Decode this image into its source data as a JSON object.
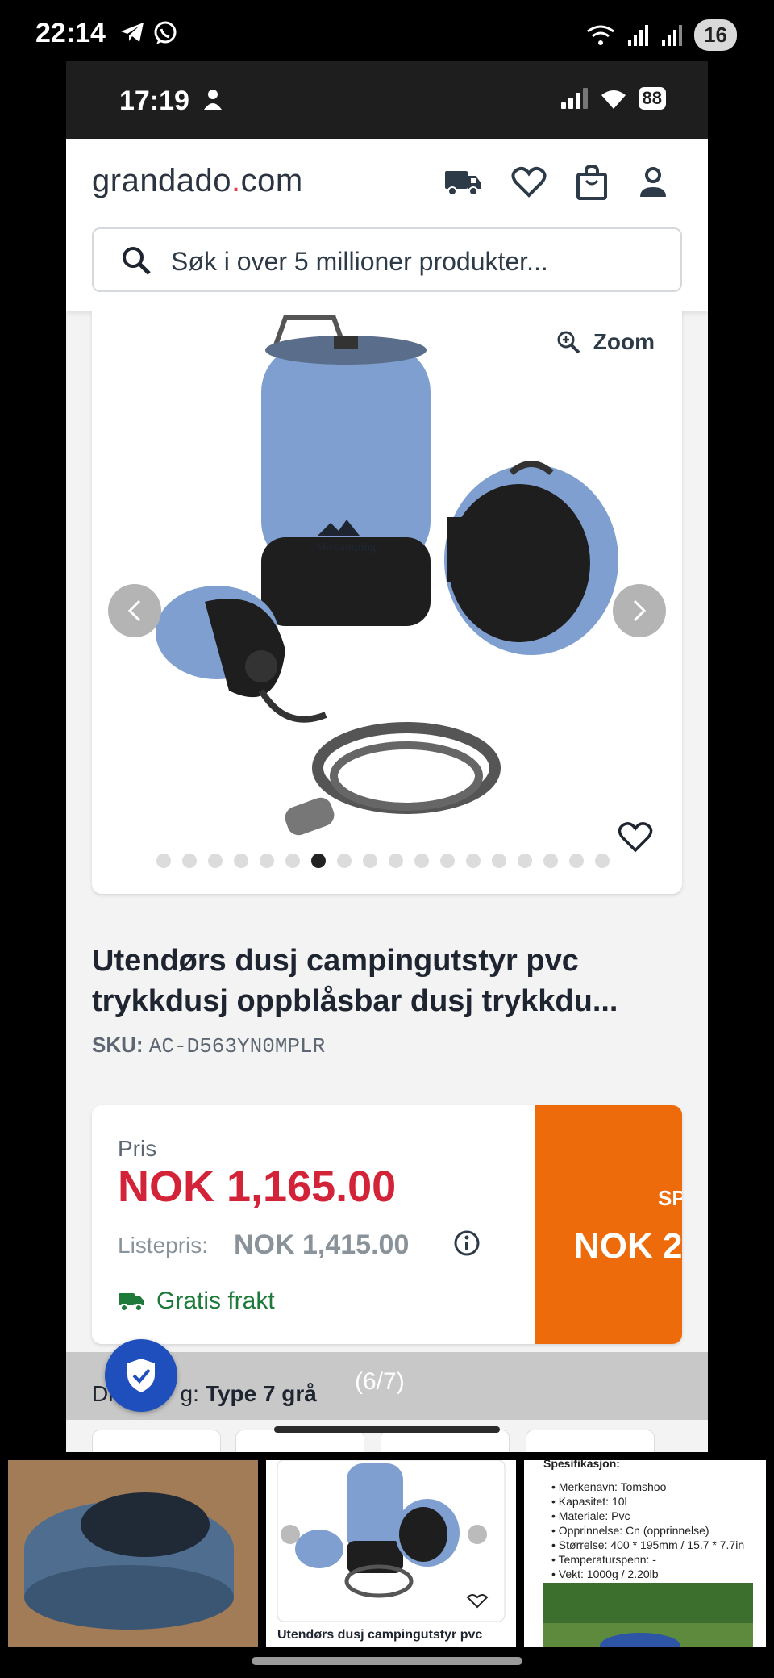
{
  "outer_status": {
    "time": "22:14",
    "battery": "16"
  },
  "inner_status": {
    "time": "17:19",
    "battery": "88"
  },
  "header": {
    "logo_part1": "grandado",
    "logo_dot": ".",
    "logo_part2": "com",
    "search_placeholder": "Søk i over 5 millioner produkter..."
  },
  "gallery": {
    "zoom_label": "Zoom",
    "dots_total": 18,
    "active_dot": 7,
    "product_brand": "Skycamping"
  },
  "product": {
    "title": "Utendørs dusj campingutstyr pvc trykkdusj oppblåsbar dusj trykkdu...",
    "sku_label": "SKU:",
    "sku_value": "AC-D563YN0MPLR"
  },
  "pricing": {
    "price_label": "Pris",
    "price": "NOK 1,165.00",
    "list_label": "Listepris:",
    "list_price": "NOK 1,415.00",
    "shipping": "Gratis frakt",
    "sale_label": "SP",
    "sale_price": "NOK 2"
  },
  "variant": {
    "label": "Dr",
    "label_tail": "g:",
    "value": "Type 7 grå",
    "counter": "(6/7)"
  },
  "thumbnails": {
    "spec_heading": "Spesifikasjon:",
    "spec_items": [
      "• Merkenavn: Tomshoo",
      "• Kapasitet: 10l",
      "• Materiale: Pvc",
      "• Opprinnelse: Cn (opprinnelse)",
      "• Størrelse: 400 * 195mm / 15.7 * 7.7in",
      "• Temperaturspenn: -",
      "• Vekt: 1000g / 2.20lb"
    ],
    "thumb2_title": "Utendørs dusj campingutstyr pvc"
  },
  "colors": {
    "price_red": "#d32338",
    "sale_orange": "#ed6b0b",
    "shipping_green": "#1d7a3a",
    "shield_blue": "#1f4fbd",
    "product_blue": "#7f9fd0"
  }
}
